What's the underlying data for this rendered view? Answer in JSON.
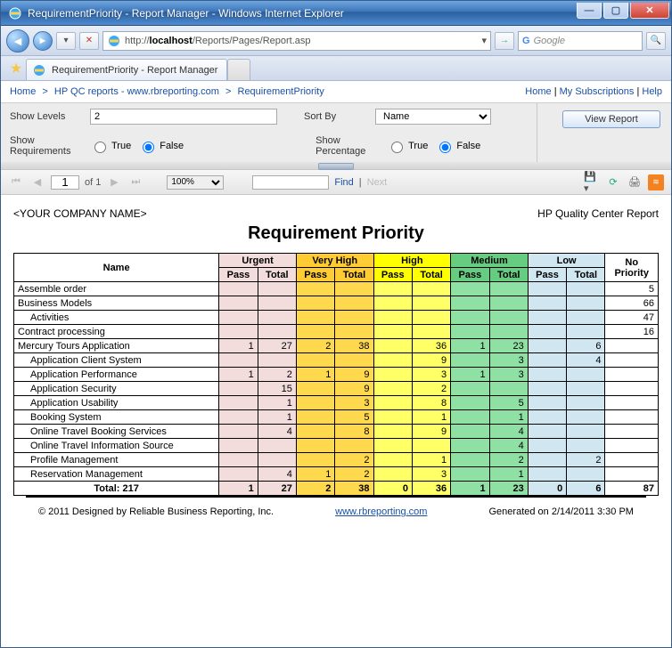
{
  "window": {
    "title": "RequirementPriority - Report Manager - Windows Internet Explorer"
  },
  "addressbar": {
    "url_prefix": "http://",
    "url_host": "localhost",
    "url_path": "/Reports/Pages/Report.asp"
  },
  "search": {
    "placeholder": "Google"
  },
  "tab": {
    "title": "RequirementPriority - Report Manager"
  },
  "breadcrumbs": {
    "home": "Home",
    "hpqc": "HP QC reports - www.rbreporting.com",
    "current": "RequirementPriority",
    "right_home": "Home",
    "subs": "My Subscriptions",
    "help": "Help"
  },
  "params": {
    "show_levels_label": "Show Levels",
    "show_levels_value": "2",
    "sort_by_label": "Sort By",
    "sort_by_value": "Name",
    "show_req_label": "Show\nRequirements",
    "show_pct_label": "Show\nPercentage",
    "true_label": "True",
    "false_label": "False",
    "view_report": "View Report"
  },
  "viewer": {
    "page": "1",
    "of": "of 1",
    "zoom": "100%",
    "find": "Find",
    "next": "Next"
  },
  "report": {
    "company": "<YOUR COMPANY NAME>",
    "topright": "HP Quality Center Report",
    "title": "Requirement Priority",
    "headers": {
      "name": "Name",
      "urgent": "Urgent",
      "vhigh": "Very High",
      "high": "High",
      "medium": "Medium",
      "low": "Low",
      "nopri": "No\nPriority",
      "pass": "Pass",
      "total": "Total"
    },
    "rows": [
      {
        "name": "Assemble order",
        "indent": 0,
        "vals": [
          "",
          "",
          "",
          "",
          "",
          "",
          "",
          "",
          "",
          "",
          "5"
        ]
      },
      {
        "name": "Business Models",
        "indent": 0,
        "vals": [
          "",
          "",
          "",
          "",
          "",
          "",
          "",
          "",
          "",
          "",
          "66"
        ]
      },
      {
        "name": "Activities",
        "indent": 1,
        "vals": [
          "",
          "",
          "",
          "",
          "",
          "",
          "",
          "",
          "",
          "",
          "47"
        ]
      },
      {
        "name": "Contract processing",
        "indent": 0,
        "vals": [
          "",
          "",
          "",
          "",
          "",
          "",
          "",
          "",
          "",
          "",
          "16"
        ]
      },
      {
        "name": "Mercury Tours Application",
        "indent": 0,
        "vals": [
          "1",
          "27",
          "2",
          "38",
          "",
          "36",
          "1",
          "23",
          "",
          "6",
          ""
        ]
      },
      {
        "name": "Application Client System",
        "indent": 1,
        "vals": [
          "",
          "",
          "",
          "",
          "",
          "9",
          "",
          "3",
          "",
          "4",
          ""
        ]
      },
      {
        "name": "Application Performance",
        "indent": 1,
        "vals": [
          "1",
          "2",
          "1",
          "9",
          "",
          "3",
          "1",
          "3",
          "",
          "",
          ""
        ]
      },
      {
        "name": "Application Security",
        "indent": 1,
        "vals": [
          "",
          "15",
          "",
          "9",
          "",
          "2",
          "",
          "",
          "",
          "",
          ""
        ]
      },
      {
        "name": "Application Usability",
        "indent": 1,
        "vals": [
          "",
          "1",
          "",
          "3",
          "",
          "8",
          "",
          "5",
          "",
          "",
          ""
        ]
      },
      {
        "name": "Booking System",
        "indent": 1,
        "vals": [
          "",
          "1",
          "",
          "5",
          "",
          "1",
          "",
          "1",
          "",
          "",
          ""
        ]
      },
      {
        "name": "Online Travel Booking Services",
        "indent": 1,
        "vals": [
          "",
          "4",
          "",
          "8",
          "",
          "9",
          "",
          "4",
          "",
          "",
          ""
        ]
      },
      {
        "name": "Online Travel Information Source",
        "indent": 1,
        "vals": [
          "",
          "",
          "",
          "",
          "",
          "",
          "",
          "4",
          "",
          "",
          ""
        ]
      },
      {
        "name": "Profile Management",
        "indent": 1,
        "vals": [
          "",
          "",
          "",
          "2",
          "",
          "1",
          "",
          "2",
          "",
          "2",
          ""
        ]
      },
      {
        "name": "Reservation Management",
        "indent": 1,
        "vals": [
          "",
          "4",
          "1",
          "2",
          "",
          "3",
          "",
          "1",
          "",
          "",
          ""
        ]
      }
    ],
    "total": {
      "label": "Total: 217",
      "vals": [
        "1",
        "27",
        "2",
        "38",
        "0",
        "36",
        "1",
        "23",
        "0",
        "6",
        "87"
      ]
    }
  },
  "footer": {
    "copyright": "© 2011 Designed by Reliable Business Reporting, Inc.",
    "link": "www.rbreporting.com",
    "generated": "Generated on 2/14/2011 3:30 PM"
  }
}
